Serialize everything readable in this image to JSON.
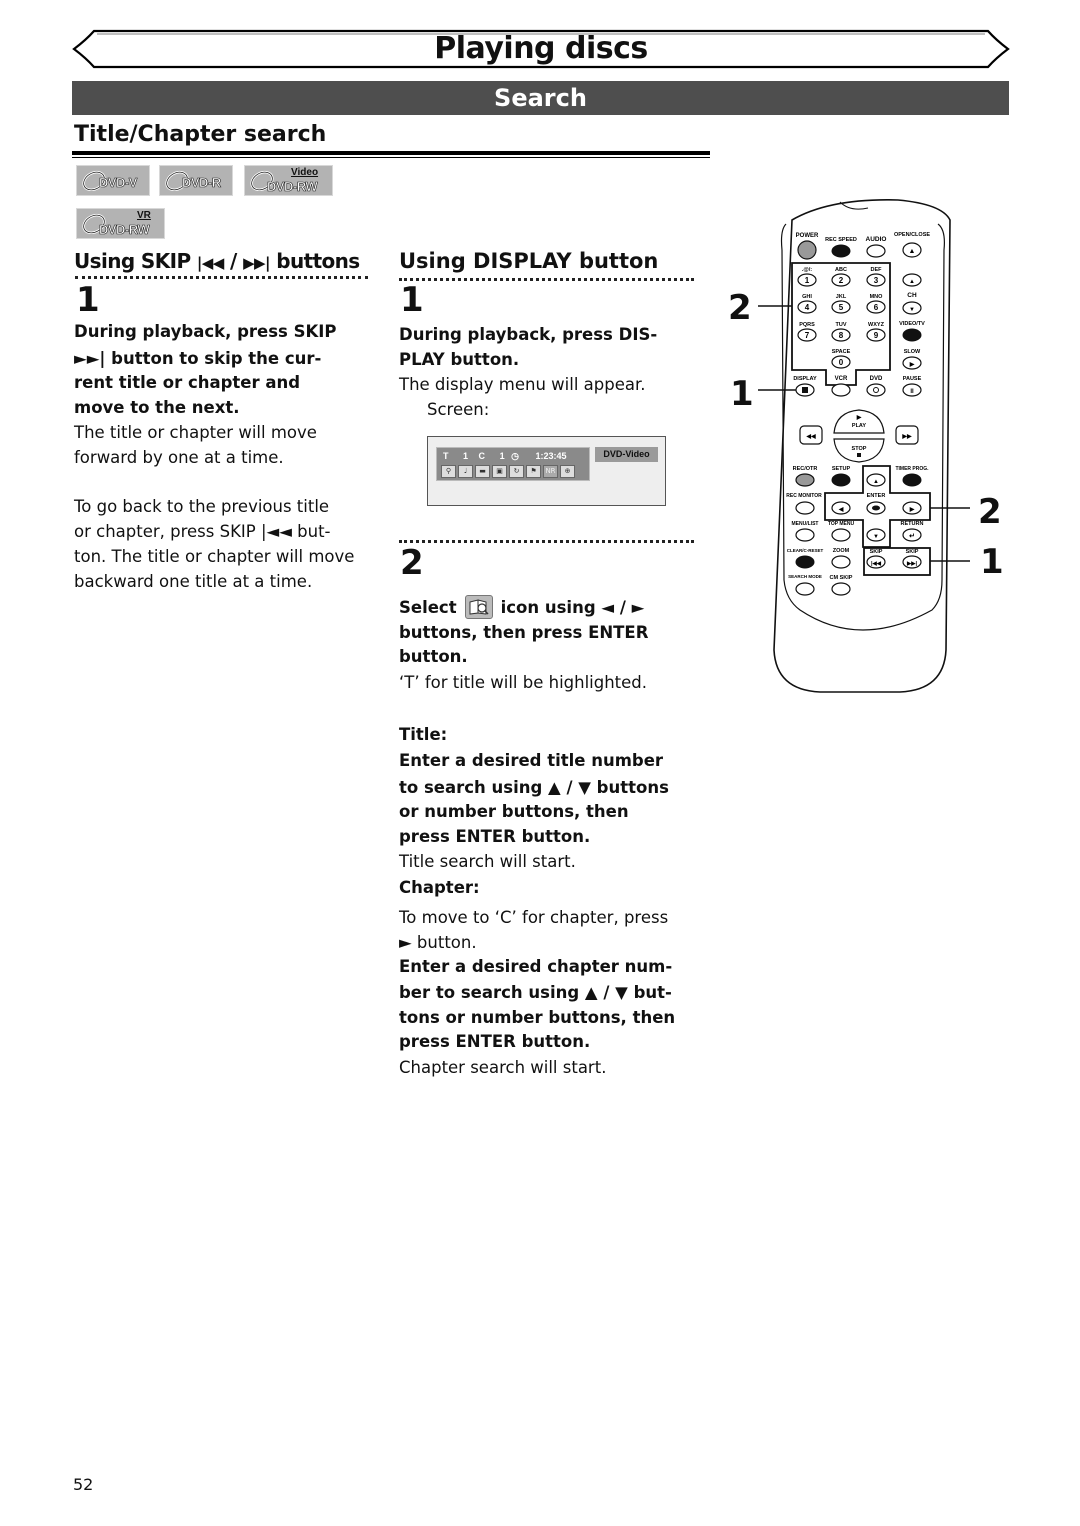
{
  "header": {
    "title": "Playing discs",
    "section": "Search"
  },
  "subsection": {
    "title": "Title/Chapter search"
  },
  "disc_badges": [
    {
      "label": "DVD-V",
      "sup": ""
    },
    {
      "label": "DVD-R",
      "sup": ""
    },
    {
      "label": "DVD-RW",
      "sup": "Video"
    },
    {
      "label": "DVD-RW",
      "sup": "VR"
    }
  ],
  "left_col": {
    "heading": "Using SKIP ⏮ / ⏭ buttons",
    "heading_prefix": "Using SKIP",
    "heading_suffix": "buttons",
    "step1": {
      "num": "1",
      "instruction_lines": [
        "During playback, press SKIP",
        "►►| button to skip the cur-",
        "rent title or chapter and",
        "move to the next."
      ],
      "note_lines": [
        "The title or chapter will move",
        "forward by one at a time."
      ],
      "back_lines": [
        "To go back to the previous title",
        "or chapter, press SKIP |◄◄ but-",
        "ton. The title or chapter will move",
        "backward one title at a time."
      ]
    }
  },
  "right_col": {
    "heading": "Using DISPLAY button",
    "step1": {
      "num": "1",
      "instruction_lines": [
        "During playback, press DIS-",
        "PLAY button."
      ],
      "note": "The display menu will appear.",
      "screen_label": "Screen:"
    },
    "screen": {
      "t_label": "T",
      "title_num": "1",
      "c_label": "C",
      "chapter_num": "1",
      "time": "1:23:45",
      "disc_type": "DVD-Video",
      "icons": [
        "search-icon",
        "audio-icon",
        "subtitle-icon",
        "angle-icon",
        "repeat-icon",
        "marker-icon",
        "nr-icon",
        "zoom-icon"
      ],
      "nr_text": "NR"
    },
    "step2": {
      "num": "2",
      "select_word": "Select",
      "icon_text": "icon using ◄ / ►",
      "instruction_lines": [
        "buttons, then press ENTER",
        "button."
      ],
      "note": "‘T’ for title will be highlighted.",
      "title_label": "Title:",
      "title_lines": [
        "Enter a desired title number",
        "to search using ▲ / ▼ buttons",
        "or number buttons, then",
        "press ENTER button."
      ],
      "title_note": "Title search will start.",
      "chapter_label": "Chapter:",
      "chapter_move_lines": [
        "To move to ‘C’ for chapter, press",
        "► button."
      ],
      "chapter_lines": [
        "Enter a desired chapter num-",
        "ber to search using ▲ / ▼ but-",
        "tons or number buttons, then",
        "press ENTER button."
      ],
      "chapter_note": "Chapter search will start."
    }
  },
  "remote": {
    "labels": {
      "power": "POWER",
      "rec_speed": "REC SPEED",
      "audio": "AUDIO",
      "open_close": "OPEN/CLOSE",
      "k1": ".@/:",
      "k2": "ABC",
      "k3": "DEF",
      "k4": "GHI",
      "k5": "JKL",
      "k6": "MNO",
      "k7": "PQRS",
      "k8": "TUV",
      "k9": "WXYZ",
      "k0": "SPACE",
      "ch": "CH",
      "video_tv": "VIDEO/TV",
      "slow": "SLOW",
      "display": "DISPLAY",
      "vcr": "VCR",
      "dvd": "DVD",
      "pause": "PAUSE",
      "play": "PLAY",
      "stop": "STOP",
      "rec_otr": "REC/OTR",
      "setup": "SETUP",
      "timer_prog": "TIMER PROG.",
      "rec_monitor": "REC MONITOR",
      "enter": "ENTER",
      "menu_list": "MENU/LIST",
      "top_menu": "TOP MENU",
      "return": "RETURN",
      "clear_reset": "CLEAR/C-RESET",
      "zoom": "ZOOM",
      "skip_back": "SKIP",
      "skip_fwd": "SKIP",
      "search_mode": "SEARCH MODE",
      "cm_skip": "CM SKIP"
    },
    "digits": [
      "1",
      "2",
      "3",
      "4",
      "5",
      "6",
      "7",
      "8",
      "9",
      "0"
    ],
    "callouts": {
      "numbers_left": "2",
      "display_left": "1",
      "arrows_right": "2",
      "skip_right": "1"
    }
  },
  "page_number": "52"
}
